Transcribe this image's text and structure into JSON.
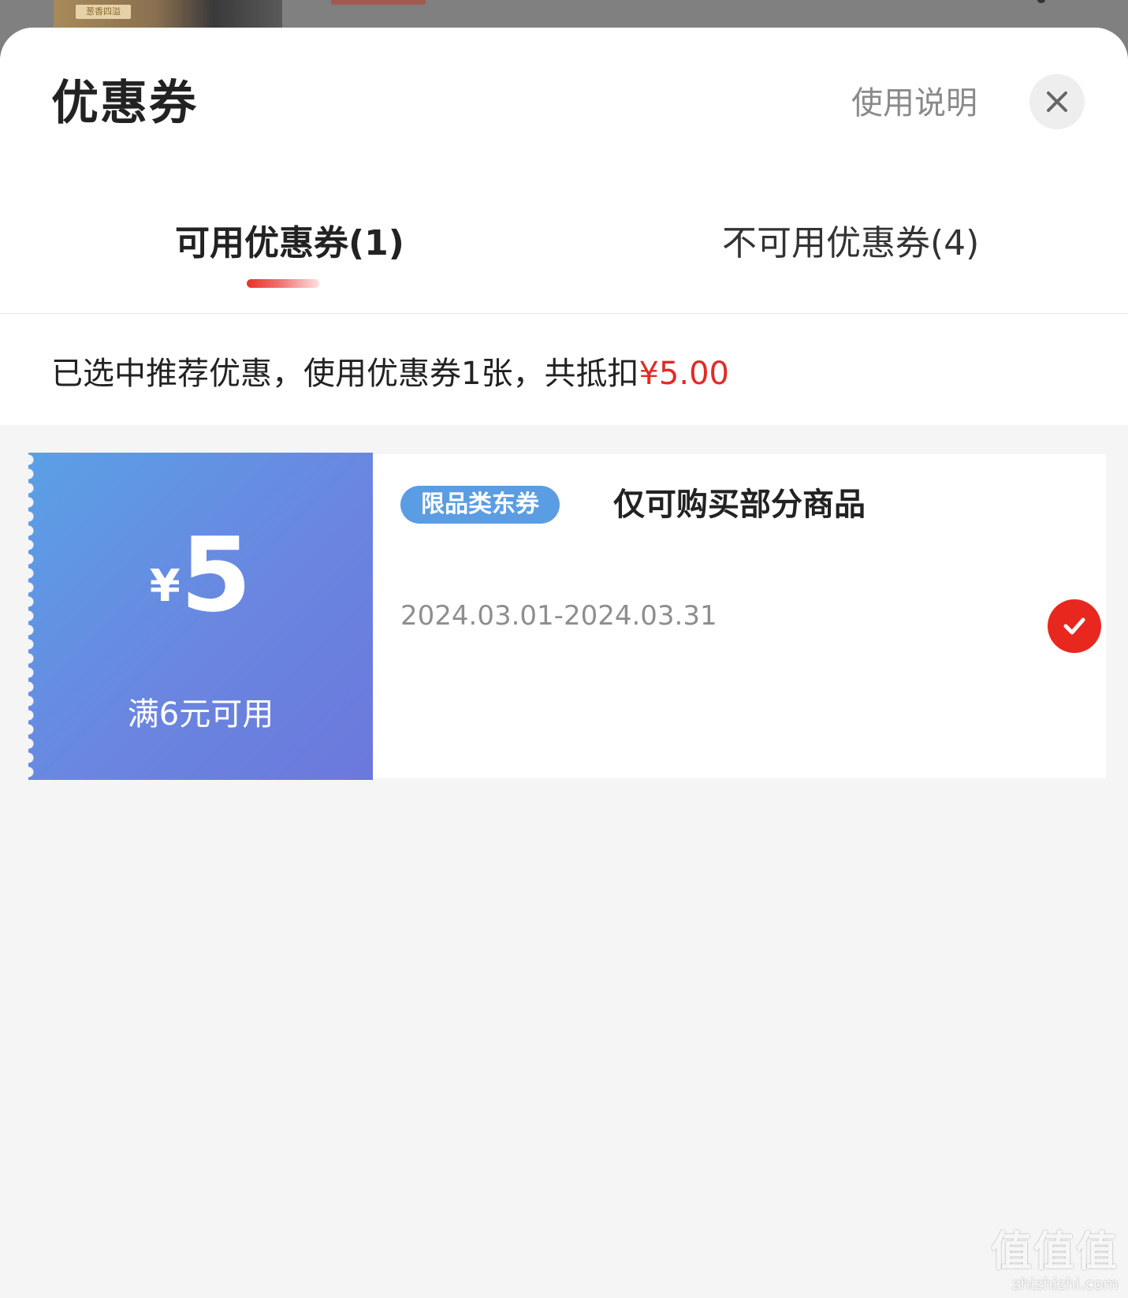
{
  "background": {
    "thumb_label": "葱香四溢"
  },
  "sheet": {
    "title": "优惠券",
    "help_label": "使用说明",
    "close_icon": "close-icon"
  },
  "tabs": [
    {
      "label": "可用优惠券(1)",
      "active": true
    },
    {
      "label": "不可用优惠券(4)",
      "active": false
    }
  ],
  "summary": {
    "text": "已选中推荐优惠，使用优惠券1张，共抵扣",
    "amount": "¥5.00"
  },
  "coupon": {
    "currency": "¥",
    "value": "5",
    "condition": "满6元可用",
    "tag": "限品类东券",
    "description": "仅可购买部分商品",
    "validity": "2024.03.01-2024.03.31",
    "selected": true,
    "check_icon": "checkmark-icon"
  },
  "watermark": {
    "mark": "值值值",
    "url": "zhizhizhi.com"
  },
  "colors": {
    "accent_red": "#e8281e",
    "coupon_blue_start": "#5aa0e6",
    "coupon_blue_end": "#6b78dc",
    "tag_blue": "#5b9de3"
  }
}
